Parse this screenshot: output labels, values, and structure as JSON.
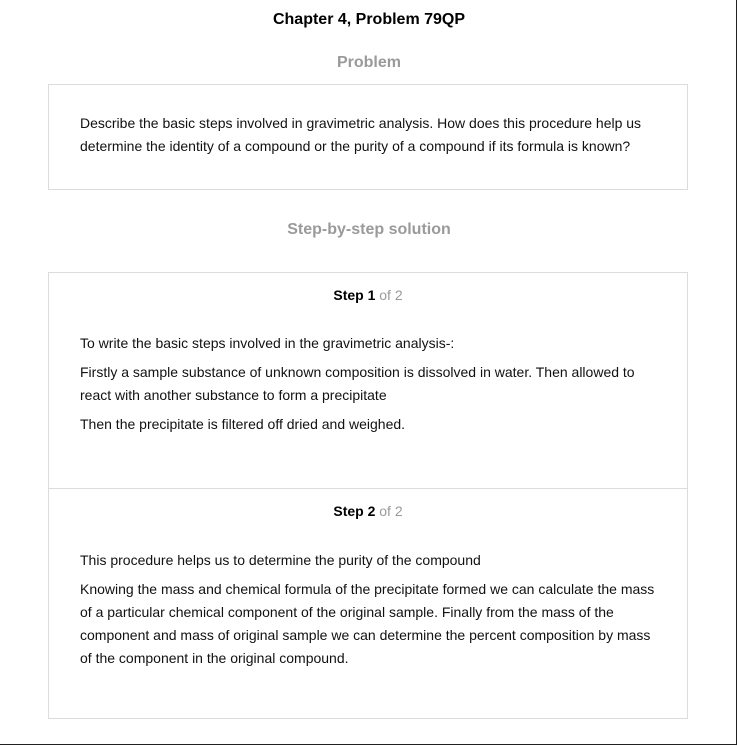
{
  "page": {
    "title": "Chapter 4, Problem 79QP"
  },
  "problem": {
    "heading": "Problem",
    "text": "Describe the basic steps involved in gravimetric analysis. How does this procedure help us determine the identity of a compound or the purity of a compound if its formula is known?"
  },
  "solution": {
    "heading": "Step-by-step solution",
    "steps": [
      {
        "label": "Step 1",
        "of_text": "of 2",
        "paragraphs": [
          "To write the basic steps involved in the gravimetric analysis-:",
          "Firstly a sample substance of unknown composition is dissolved in water. Then allowed to react with another substance to form a precipitate",
          "Then the precipitate is filtered off dried and weighed."
        ]
      },
      {
        "label": "Step 2",
        "of_text": "of 2",
        "paragraphs": [
          "This procedure helps us to determine the purity of the compound",
          "Knowing the mass and chemical formula of the precipitate formed we can calculate the mass of a particular chemical component of the original sample. Finally from the mass of the component and mass of original sample we can determine the percent composition by mass of the component in the original compound."
        ]
      }
    ]
  }
}
